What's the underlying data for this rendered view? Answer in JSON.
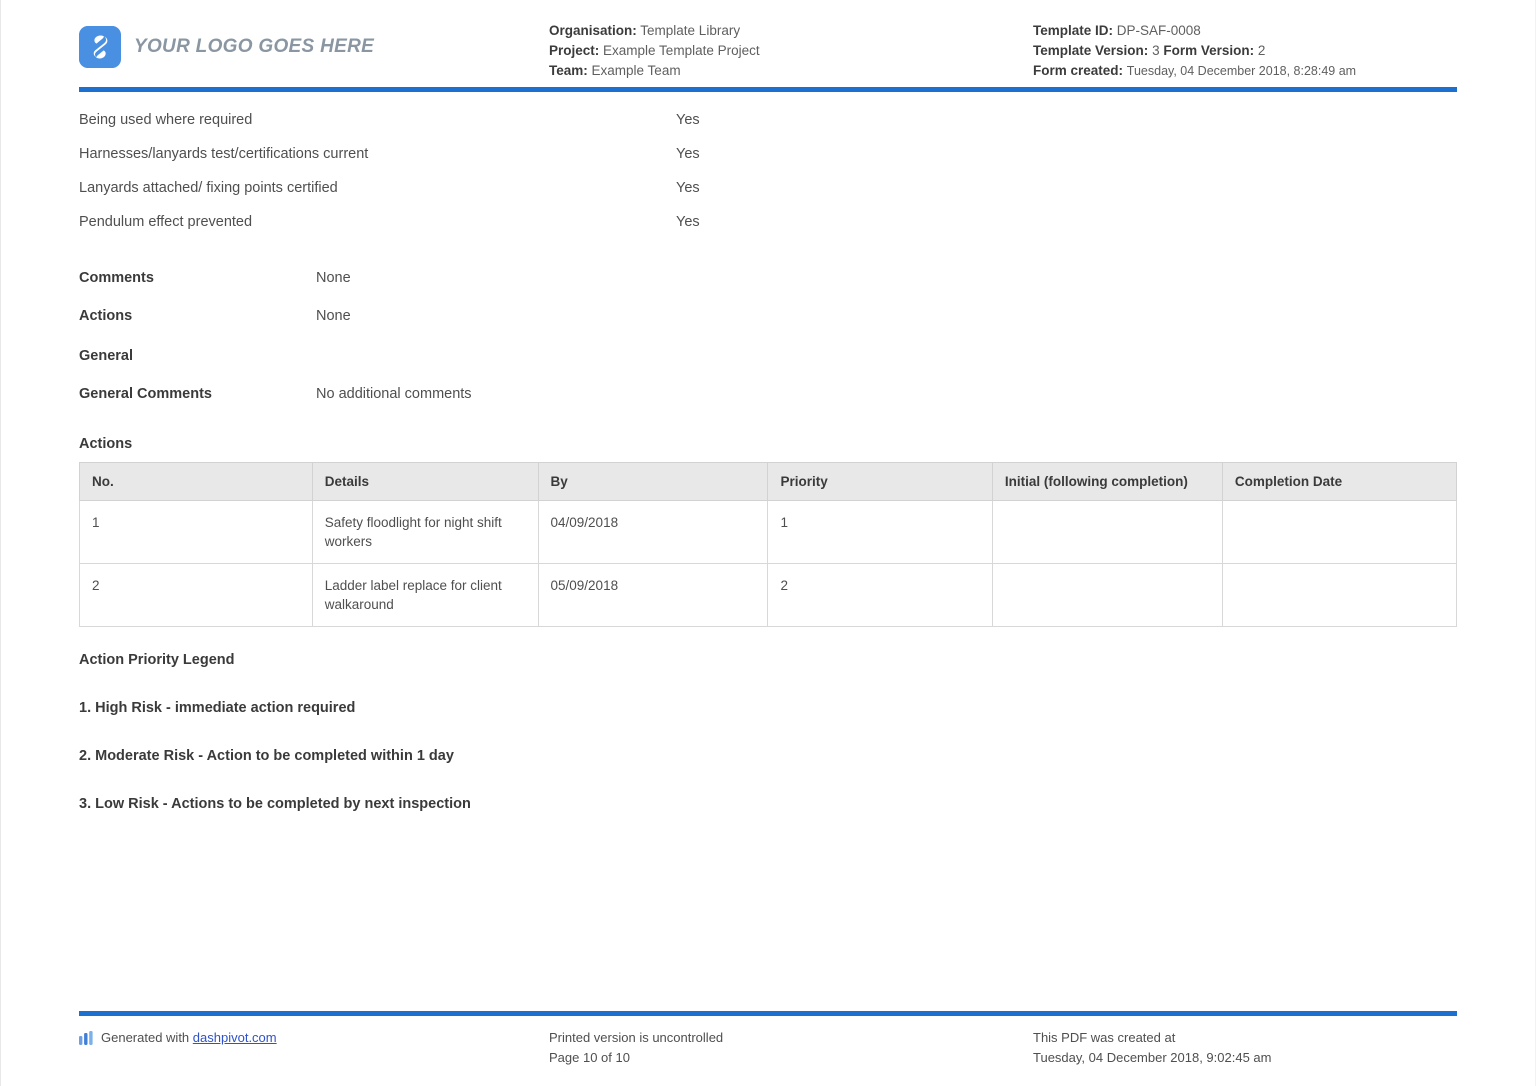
{
  "header": {
    "logo_text": "YOUR LOGO GOES HERE",
    "organisation_label": "Organisation:",
    "organisation_value": "Template Library",
    "project_label": "Project:",
    "project_value": "Example Template Project",
    "team_label": "Team:",
    "team_value": "Example Team",
    "template_id_label": "Template ID:",
    "template_id_value": "DP-SAF-0008",
    "template_version_label": "Template Version:",
    "template_version_value": "3",
    "form_version_label": "Form Version:",
    "form_version_value": "2",
    "form_created_label": "Form created:",
    "form_created_value": "Tuesday, 04 December 2018, 8:28:49 am"
  },
  "checklist": [
    {
      "question": "Being used where required",
      "answer": "Yes"
    },
    {
      "question": "Harnesses/lanyards test/certifications current",
      "answer": "Yes"
    },
    {
      "question": "Lanyards attached/ fixing points certified",
      "answer": "Yes"
    },
    {
      "question": "Pendulum effect prevented",
      "answer": "Yes"
    }
  ],
  "fields": {
    "comments_label": "Comments",
    "comments_value": "None",
    "actions_label": "Actions",
    "actions_value": "None",
    "general_heading": "General",
    "general_comments_label": "General Comments",
    "general_comments_value": "No additional comments"
  },
  "actions_table": {
    "title": "Actions",
    "columns": [
      "No.",
      "Details",
      "By",
      "Priority",
      "Initial (following completion)",
      "Completion Date"
    ],
    "rows": [
      {
        "no": "1",
        "details": "Safety floodlight for night shift workers",
        "by": "04/09/2018",
        "priority": "1",
        "initial": "",
        "completion_date": ""
      },
      {
        "no": "2",
        "details": "Ladder label replace for client walkaround",
        "by": "05/09/2018",
        "priority": "2",
        "initial": "",
        "completion_date": ""
      }
    ]
  },
  "legend": {
    "title": "Action Priority Legend",
    "items": [
      "1. High Risk - immediate action required",
      "2. Moderate Risk - Action to be completed within 1 day",
      "3. Low Risk - Actions to be completed by next inspection"
    ]
  },
  "footer": {
    "generated_prefix": "Generated with",
    "generated_link": "dashpivot.com",
    "printed_notice": "Printed version is uncontrolled",
    "page_number": "Page 10 of 10",
    "pdf_created_label": "This PDF was created at",
    "pdf_created_value": "Tuesday, 04 December 2018, 9:02:45 am"
  },
  "colors": {
    "accent_blue": "#1d6fd0",
    "logo_blue": "#4a90e2",
    "link_blue": "#2f52c9",
    "table_header_bg": "#e8e8e8"
  }
}
